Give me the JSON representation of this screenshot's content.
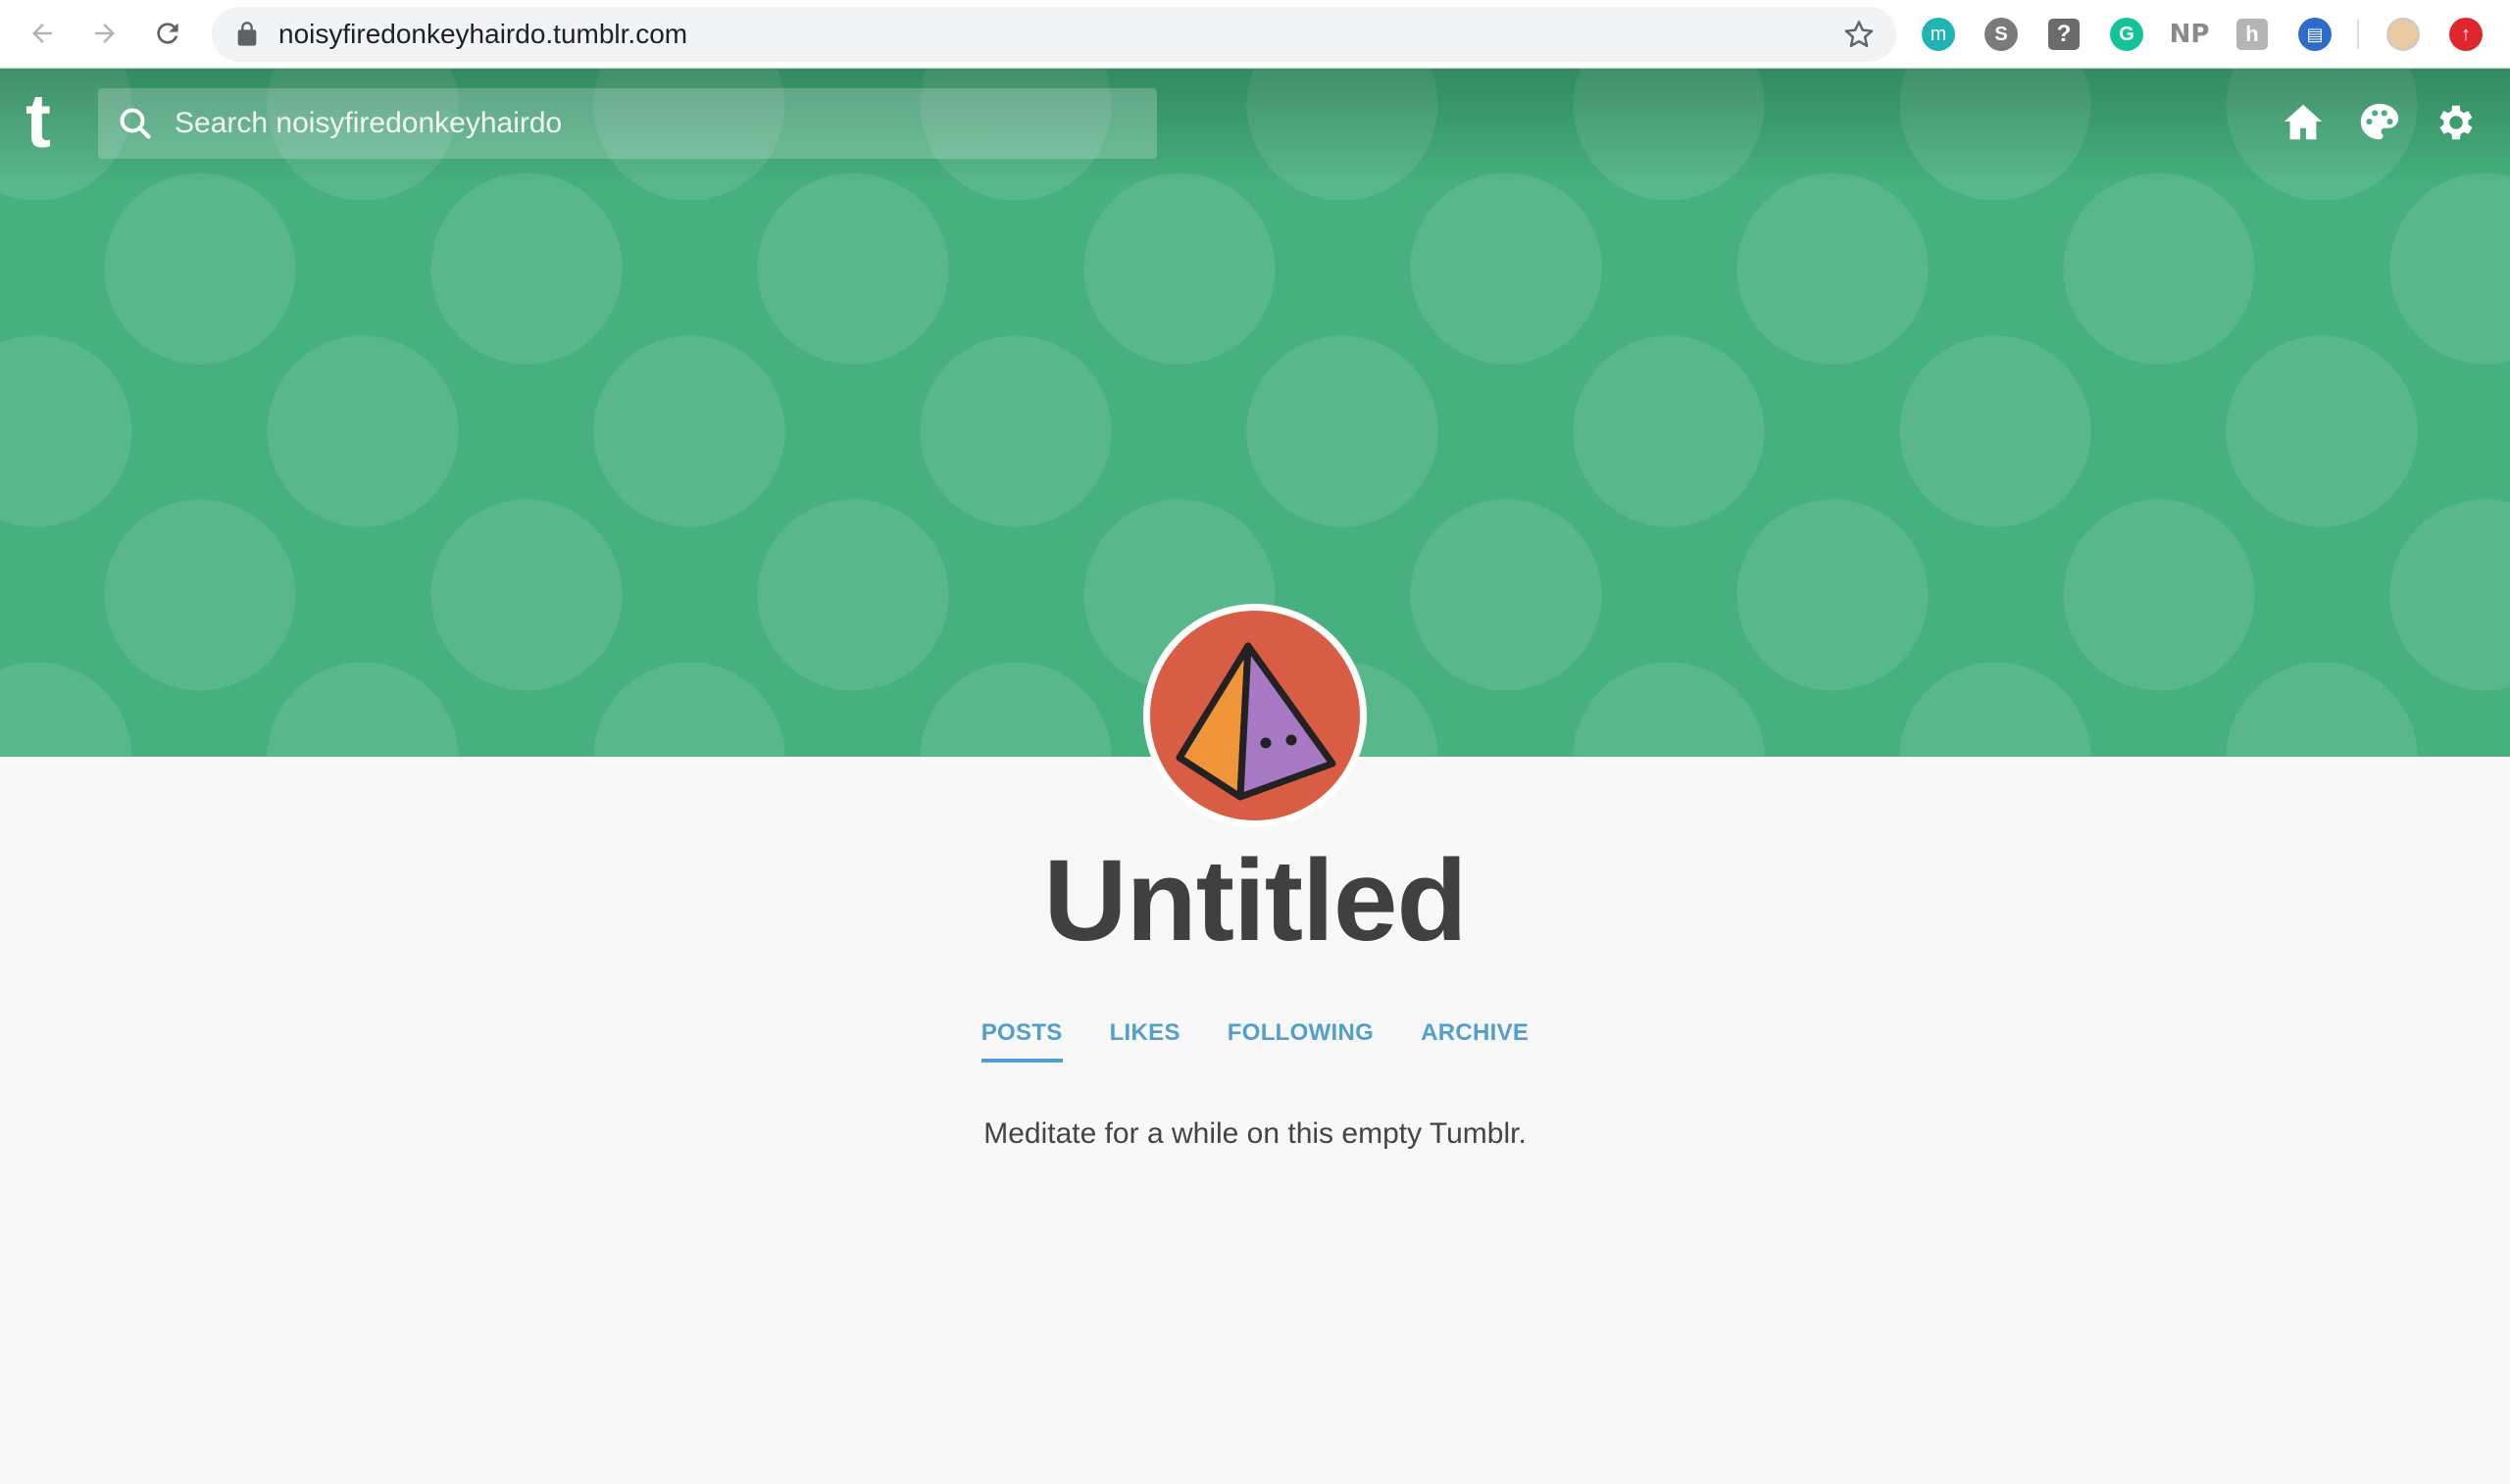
{
  "browser": {
    "url": "noisyfiredonkeyhairdo.tumblr.com",
    "icons": {
      "back": "arrow-left-icon",
      "forward": "arrow-right-icon",
      "reload": "reload-icon",
      "lock": "lock-icon",
      "bookmark": "star-icon"
    },
    "extensions": [
      {
        "name": "m-extension",
        "glyph": "m",
        "color": "#1fb3b3"
      },
      {
        "name": "skype-extension",
        "glyph": "S",
        "color": "#7a7a7a"
      },
      {
        "name": "question-extension",
        "glyph": "?",
        "color": "#6b6b6b"
      },
      {
        "name": "grammarly-extension",
        "glyph": "G",
        "color": "#15c39a"
      },
      {
        "name": "np-extension",
        "glyph": "NP",
        "color": "#8a8a8a"
      },
      {
        "name": "h-extension",
        "glyph": "h",
        "color": "#9e9e9e"
      },
      {
        "name": "docs-extension",
        "glyph": "▤",
        "color": "#2d6cc9"
      },
      {
        "name": "profile-avatar",
        "glyph": "",
        "color": "#e8c9a0"
      },
      {
        "name": "update-extension",
        "glyph": "↑",
        "color": "#e0262d"
      }
    ]
  },
  "header": {
    "logo_glyph": "t",
    "search_placeholder": "Search noisyfiredonkeyhairdo",
    "background_color": "#46b07e",
    "icons": [
      "home-icon",
      "palette-icon",
      "gear-icon"
    ]
  },
  "avatar": {
    "description_icon": "pyramid-avatar-icon",
    "colors": {
      "background": "#d95d45",
      "left_face": "#f0953a",
      "right_face": "#a779c4",
      "outline": "#222222"
    }
  },
  "blog": {
    "title": "Untitled",
    "tabs": [
      {
        "label": "POSTS",
        "active": true
      },
      {
        "label": "LIKES",
        "active": false
      },
      {
        "label": "FOLLOWING",
        "active": false
      },
      {
        "label": "ARCHIVE",
        "active": false
      }
    ],
    "empty_message": "Meditate for a while on this empty Tumblr.",
    "accent_color": "#529ecc"
  }
}
